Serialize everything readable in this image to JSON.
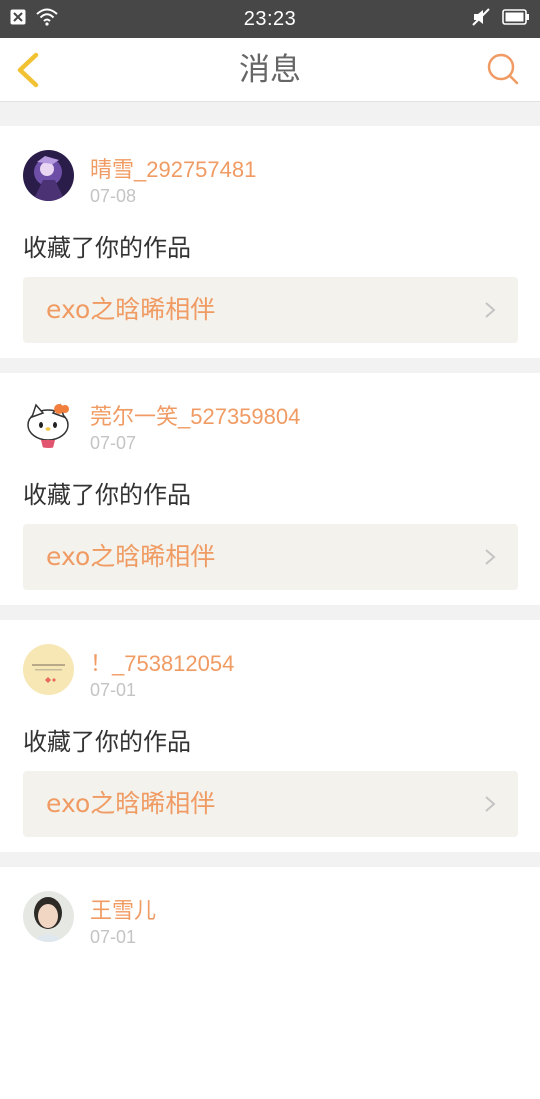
{
  "status_bar": {
    "time": "23:23",
    "icons": [
      "close-notification-icon",
      "wifi-icon",
      "mute-icon",
      "battery-icon"
    ]
  },
  "header": {
    "title": "消息",
    "back_icon": "chevron-left-icon",
    "search_icon": "search-icon"
  },
  "colors": {
    "accent": "#f09b63",
    "back_arrow": "#f1c232",
    "status_bar_bg": "#474747"
  },
  "messages": [
    {
      "user": "晴雪_292757481",
      "date": "07-08",
      "action": "收藏了你的作品",
      "work": "exo之晗晞相伴"
    },
    {
      "user": "莞尔一笑_527359804",
      "date": "07-07",
      "action": "收藏了你的作品",
      "work": "exo之晗晞相伴"
    },
    {
      "user": "！_753812054",
      "date": "07-01",
      "action": "收藏了你的作品",
      "work": "exo之晗晞相伴"
    },
    {
      "user": "王雪儿",
      "date": "07-01"
    }
  ]
}
